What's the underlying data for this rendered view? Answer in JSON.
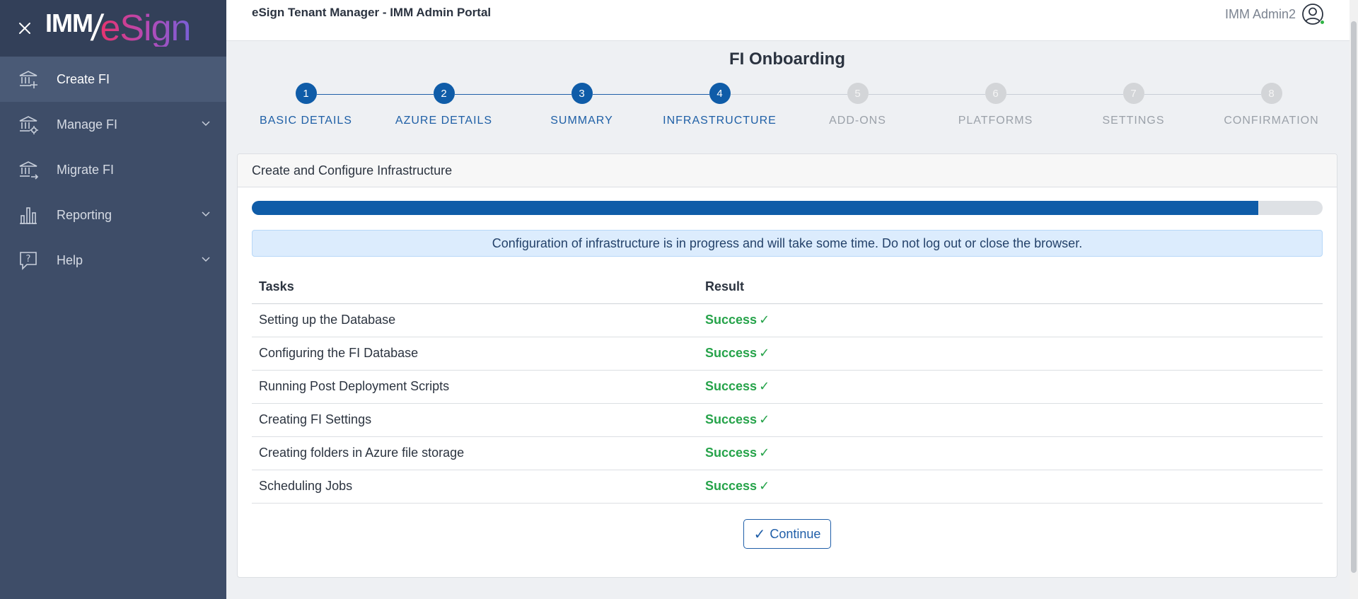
{
  "sidebar": {
    "logo": {
      "imm": "IMM",
      "slash": "/",
      "esign": "eSign"
    },
    "items": [
      {
        "label": "Create FI",
        "icon": "bank-plus-icon",
        "active": true
      },
      {
        "label": "Manage FI",
        "icon": "bank-settings-icon",
        "expandable": true
      },
      {
        "label": "Migrate FI",
        "icon": "bank-arrow-icon"
      },
      {
        "label": "Reporting",
        "icon": "bar-chart-icon",
        "expandable": true
      },
      {
        "label": "Help",
        "icon": "help-bubble-icon",
        "expandable": true
      }
    ]
  },
  "header": {
    "title": "eSign Tenant Manager - IMM Admin Portal",
    "user_name": "IMM Admin2",
    "user_status_color": "#2fb344"
  },
  "page": {
    "title": "FI Onboarding"
  },
  "stepper": {
    "current": 4,
    "steps": [
      {
        "num": "1",
        "label": "BASIC DETAILS",
        "state": "done"
      },
      {
        "num": "2",
        "label": "AZURE DETAILS",
        "state": "done"
      },
      {
        "num": "3",
        "label": "SUMMARY",
        "state": "done"
      },
      {
        "num": "4",
        "label": "INFRASTRUCTURE",
        "state": "done"
      },
      {
        "num": "5",
        "label": "ADD-ONS",
        "state": "todo"
      },
      {
        "num": "6",
        "label": "PLATFORMS",
        "state": "todo"
      },
      {
        "num": "7",
        "label": "SETTINGS",
        "state": "todo"
      },
      {
        "num": "8",
        "label": "CONFIRMATION",
        "state": "todo"
      }
    ]
  },
  "card": {
    "title": "Create and Configure Infrastructure",
    "progress_percent": 94,
    "alert": "Configuration of infrastructure is in progress and will take some time. Do not log out or close the browser.",
    "table": {
      "headers": [
        "Tasks",
        "Result"
      ],
      "rows": [
        {
          "task": "Setting up the Database",
          "result": "Success",
          "mark": "✓"
        },
        {
          "task": "Configuring the FI Database",
          "result": "Success",
          "mark": "✓"
        },
        {
          "task": "Running Post Deployment Scripts",
          "result": "Success",
          "mark": "✓"
        },
        {
          "task": "Creating FI Settings",
          "result": "Success",
          "mark": "✓"
        },
        {
          "task": "Creating folders in Azure file storage",
          "result": "Success",
          "mark": "✓"
        },
        {
          "task": "Scheduling Jobs",
          "result": "Success",
          "mark": "✓"
        }
      ]
    },
    "continue_label": "Continue",
    "continue_mark": "✓"
  },
  "colors": {
    "sidebar_bg": "#3e4d68",
    "primary": "#0f5ca8",
    "success": "#26a34a"
  }
}
